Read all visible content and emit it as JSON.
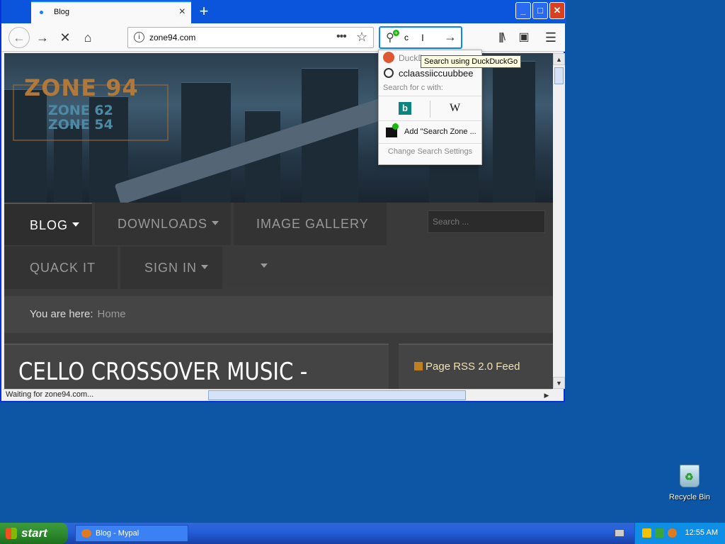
{
  "browser": {
    "tab_title": "Blog",
    "new_tab": "+",
    "url": "zone94.com",
    "search_value": "c",
    "status_text": "Waiting for zone94.com..."
  },
  "search_dropdown": {
    "engine_label": "DuckD",
    "tooltip": "Search using DuckDuckGo",
    "history_item": "cclaassiiccuubbee",
    "search_for": "Search for c with:",
    "wikipedia_glyph": "W",
    "bing_glyph": "b",
    "add_engine": "Add \"Search Zone ...",
    "settings": "Change Search Settings"
  },
  "site": {
    "logo_main": "ZONE 94",
    "logo_sub1": "ZONE 62",
    "logo_sub2": "ZONE 54",
    "nav": [
      "BLOG",
      "DOWNLOADS",
      "IMAGE GALLERY",
      "QUACK IT",
      "SIGN IN"
    ],
    "search_placeholder": "Search ...",
    "breadcrumb_label": "You are here:",
    "breadcrumb_home": "Home",
    "article_title": "CELLO CROSSOVER MUSIC - ROCK",
    "rss_label": "Page RSS 2.0 Feed"
  },
  "desktop": {
    "recycle_bin": "Recycle Bin"
  },
  "taskbar": {
    "start": "start",
    "task_label": "Blog - Mypal",
    "clock": "12:55 AM"
  },
  "colors": {
    "accent": "#0a84ff",
    "title_bar": "#0b55dc",
    "site_bg": "#3b3b3b",
    "rss_text": "#f0e1b0"
  }
}
